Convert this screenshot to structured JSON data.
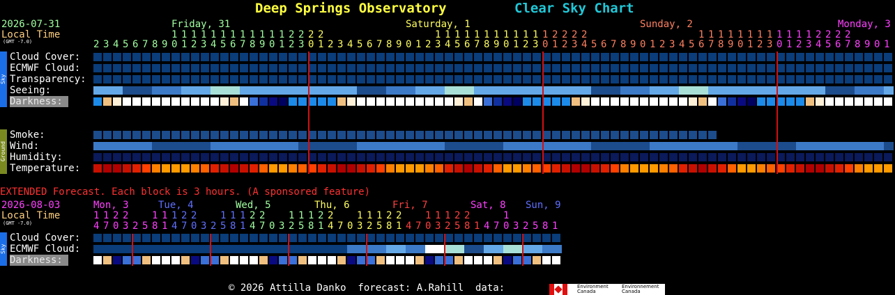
{
  "header": {
    "observatory": "Deep Springs Observatory",
    "chart_name": "Clear Sky Chart",
    "date": "2026-07-31",
    "local_time": "Local Time",
    "gmt": "(GMT -7.0)"
  },
  "days": [
    {
      "label": "Friday, 31",
      "color": "#a0ffa0"
    },
    {
      "label": "Saturday, 1",
      "color": "#ffff60"
    },
    {
      "label": "Sunday, 2",
      "color": "#ff8060"
    },
    {
      "label": "Monday, 3",
      "color": "#ff40ff"
    }
  ],
  "hour_tens": "                1 1 1 1 1 1 1 1 1 1 1 1 2 2 2 2                       1 1 1 1 1 1 1 1 1 1 1 1 2 2 2 2                       1 1 1 1 1 1 1 1 1 1 1 1 2 2 2 2                       1 1",
  "hour_ones": "2 3 4 5 6 7 8 9 0 1 2 3 4 5 6 7 8 9 0 1 2 3 0 1 2 3 4 5 6 7 8 9 0 1 2 3 4 5 6 7 8 9 0 1 2 3 0 1 2 3 4 5 6 7 8 9 0 1 2 3 4 5 6 7 8 9 0 1 2 3 0 1 2 3 4 5 6 7 8 9 0 1",
  "sky_section": {
    "sidebar": "Sky",
    "rows": [
      "Cloud Cover:",
      "ECMWF Cloud:",
      "Transparency:",
      "Seeing:",
      "Darkness:"
    ]
  },
  "ground_section": {
    "sidebar": "Ground",
    "rows": [
      "Smoke:",
      "Wind:",
      "Humidity:",
      "Temperature:"
    ]
  },
  "extended": {
    "banner": "EXTENDED Forecast. Each block is 3 hours. (A sponsored feature)",
    "date": "2026-08-03",
    "local_time": "Local Time",
    "gmt": "(GMT -7.0)",
    "days": [
      {
        "label": "Mon, 3",
        "color": "#ff40ff"
      },
      {
        "label": "Tue, 4",
        "color": "#6070ff"
      },
      {
        "label": "Wed, 5",
        "color": "#a0ffa0"
      },
      {
        "label": "Thu, 6",
        "color": "#ffff60"
      },
      {
        "label": "Fri, 7",
        "color": "#ff4040"
      },
      {
        "label": "Sat, 8",
        "color": "#ff40ff"
      },
      {
        "label": "Sun, 9",
        "color": "#6070ff"
      }
    ],
    "hour_tens": "1 1 2 2     1 1 1 2 2     1 1 1 2 2     1 1 1 2 2     1 1 1 2 2     1 1 1 2 2       1",
    "hour_ones": "4 7 0 3 2 5 8 1 4 7 0 3 2 5 8 1 4 7 0 3 2 5 8 1 4 7 0 3 2 5 8 1 4 7 0 3 2 5 8 1 4 7 0 3 2 5 8 1",
    "sky_rows": [
      "Cloud Cover:",
      "ECMWF Cloud:",
      "Darkness:"
    ]
  },
  "footer": {
    "text": "© 2026 Attilla Danko  forecast: A.Rahill  data:",
    "logo1": "Environment\nCanada",
    "logo2": "Environnement\nCanada"
  },
  "colors": {
    "cloud_dark": "#0a3d7a",
    "seeing_light": "#64a8e8",
    "seeing_cyan": "#a8e0d8",
    "midnight_line": "#d41010",
    "smoke": "#1c4c8c",
    "humidity": "#0a1a5a",
    "temp_orange": "#ff9a00",
    "temp_red": "#e02000"
  }
}
